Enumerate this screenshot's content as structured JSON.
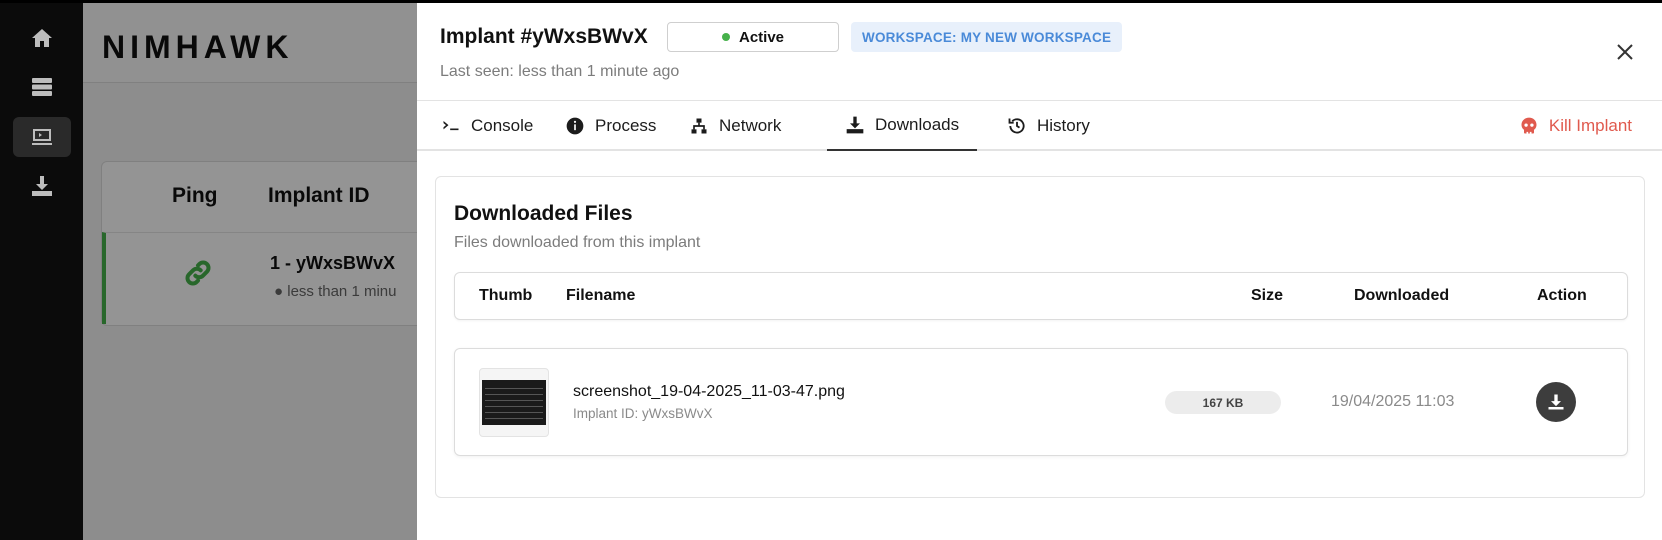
{
  "rail": {
    "items": [
      {
        "icon": "home-icon",
        "active": false
      },
      {
        "icon": "servers-icon",
        "active": false
      },
      {
        "icon": "implants-icon",
        "active": true
      },
      {
        "icon": "downloads-icon",
        "active": false
      }
    ]
  },
  "background": {
    "brand": "NIMHAWK",
    "table": {
      "headers": [
        "Ping",
        "Implant ID"
      ],
      "row": {
        "id": "1 - yWxsBWvX",
        "seen": "less than 1 minu"
      }
    }
  },
  "drawer": {
    "title": "Implant #yWxsBWvX",
    "status": "Active",
    "status_color": "#46b14b",
    "workspace": "WORKSPACE: MY NEW WORKSPACE",
    "last_seen": "Last seen: less than 1 minute ago",
    "tabs": [
      {
        "label": "Console",
        "icon": "terminal-icon",
        "active": false
      },
      {
        "label": "Process",
        "icon": "info-icon",
        "active": false
      },
      {
        "label": "Network",
        "icon": "network-icon",
        "active": false
      },
      {
        "label": "Downloads",
        "icon": "download-icon",
        "active": true
      },
      {
        "label": "History",
        "icon": "history-icon",
        "active": false
      }
    ],
    "kill_label": "Kill Implant",
    "kill_color": "#e05a4e"
  },
  "downloads": {
    "title": "Downloaded Files",
    "subtitle": "Files downloaded from this implant",
    "columns": [
      "Thumb",
      "Filename",
      "Size",
      "Downloaded",
      "Action"
    ],
    "files": [
      {
        "filename": "screenshot_19-04-2025_11-03-47.png",
        "implant": "Implant ID: yWxsBWvX",
        "size": "167 KB",
        "downloaded": "19/04/2025 11:03"
      }
    ]
  }
}
